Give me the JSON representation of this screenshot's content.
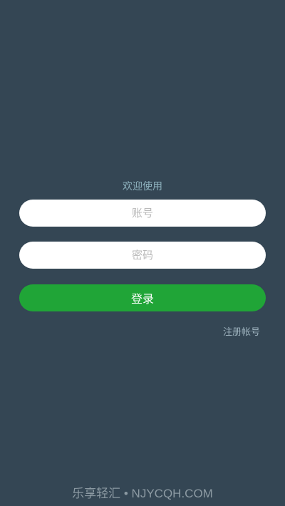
{
  "login": {
    "welcome_text": "欢迎使用",
    "account_placeholder": "账号",
    "password_placeholder": "密码",
    "login_button_label": "登录",
    "register_link_label": "注册帐号"
  },
  "watermark": {
    "text": "乐享轻汇 • NJYCQH.COM"
  },
  "colors": {
    "background": "#344654",
    "input_background": "#ffffff",
    "button_green": "#20a537",
    "welcome_text": "#8fb3bf",
    "link_text": "#9fb4bf"
  }
}
